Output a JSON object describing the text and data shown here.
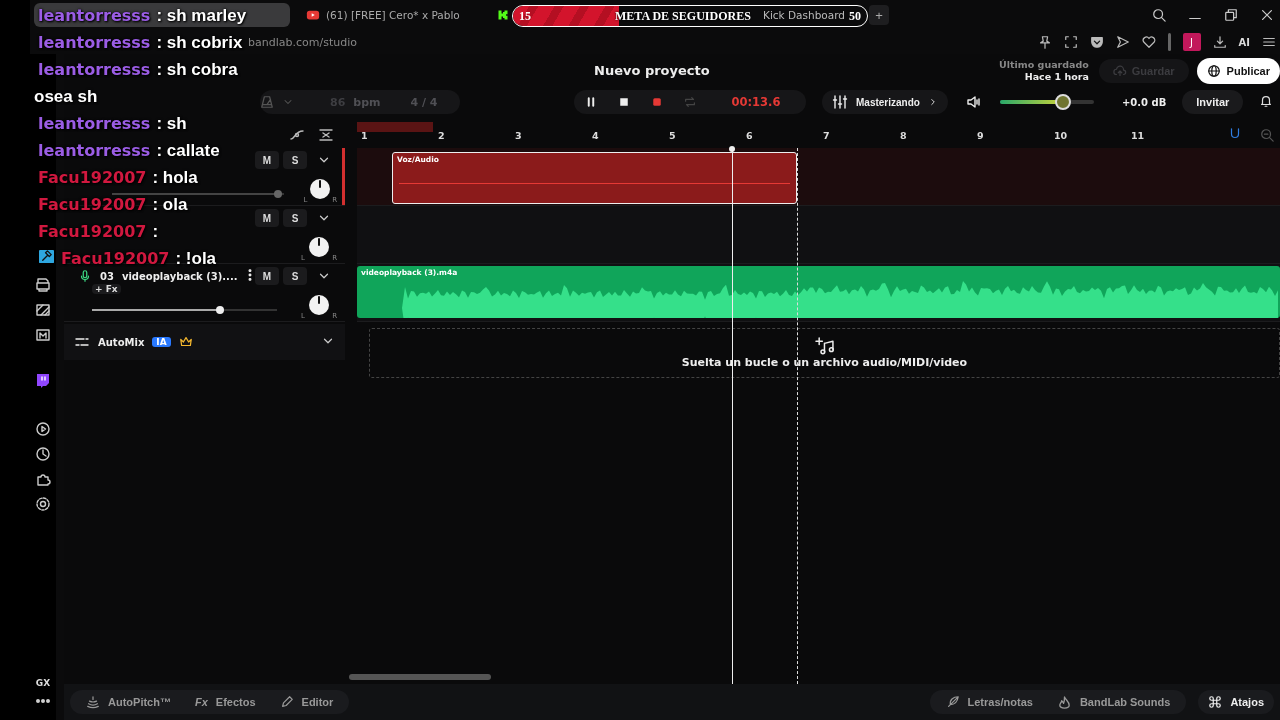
{
  "browser": {
    "tabs": [
      {
        "kind": "blank",
        "selected": true
      },
      {
        "kind": "video",
        "title": "(61) [FREE] Cero* x Pablo",
        "selected": false
      },
      {
        "kind": "kick",
        "title": "Kick Dashboard",
        "selected": false
      }
    ],
    "new_tab": "+",
    "address": "bandlab.com/studio",
    "avatar": "J",
    "ai": "AI",
    "sidebar_bottom": "GX"
  },
  "follower_goal": {
    "current": "15",
    "title": "META DE SEGUIDORES",
    "target": "50",
    "level": 0.3
  },
  "chat_overlay": {
    "messages": [
      {
        "user": "leantorresss",
        "color": "#9b5de5",
        "text": ": sh marley",
        "badge": false
      },
      {
        "user": "leantorresss",
        "color": "#9b5de5",
        "text": ": sh cobrix",
        "badge": false
      },
      {
        "user": "leantorresss",
        "color": "#9b5de5",
        "text": ": sh cobra",
        "badge": false
      },
      {
        "text": "osea sh"
      },
      {
        "user": "leantorresss",
        "color": "#9b5de5",
        "text": ": sh",
        "badge": false
      },
      {
        "user": "leantorresss",
        "color": "#9b5de5",
        "text": ": callate",
        "badge": false
      },
      {
        "user": "Facu192007",
        "color": "#d0183f",
        "text": ": hola",
        "badge": false
      },
      {
        "user": "Facu192007",
        "color": "#d0183f",
        "text": ": ola",
        "badge": false
      },
      {
        "user": "Facu192007",
        "color": "#d0183f",
        "text": ":",
        "badge": false
      },
      {
        "user": "Facu192007",
        "color": "#d0183f",
        "text": ": !ola",
        "badge": true
      }
    ]
  },
  "header": {
    "title": "Nuevo proyecto",
    "last_saved_label": "Último guardado",
    "last_saved": "Hace 1 hora",
    "save": "Guardar",
    "save_disabled": true,
    "publish": "Publicar"
  },
  "transport": {
    "bpm": "86",
    "bpm_unit": "bpm",
    "time_signature": "4 / 4",
    "time": "00:13.6",
    "recording": true,
    "mastering": "Masterizando",
    "volume": {
      "level": 0.67
    },
    "gain": "+0.0 dB",
    "invite": "Invitar"
  },
  "ruler": {
    "bars": [
      "1",
      "2",
      "3",
      "4",
      "5",
      "6",
      "7",
      "8",
      "9",
      "10",
      "11"
    ]
  },
  "tracks": [
    {
      "selected": true,
      "mute": "M",
      "solo": "S",
      "level": 0.97,
      "knob_l": "L",
      "knob_r": "R",
      "clip": {
        "kind": "midi",
        "name": "Voz/Audio"
      }
    },
    {
      "selected": false,
      "mute": "M",
      "solo": "S",
      "knob_l": "L",
      "knob_r": "R"
    },
    {
      "selected": false,
      "number": "03",
      "name": "videoplayback (3)....",
      "fx": "+ Fx",
      "mute": "M",
      "solo": "S",
      "level": 0.69,
      "knob_l": "L",
      "knob_r": "R",
      "clip": {
        "kind": "audio",
        "name": "videoplayback (3).m4a"
      }
    }
  ],
  "automix": {
    "label": "AutoMix",
    "badge": "IA"
  },
  "drop_zone": {
    "text": "Suelta un bucle o un archivo audio/MIDI/video"
  },
  "bottom_bar": {
    "left": [
      {
        "kind": "autopitch",
        "label": "AutoPitch™"
      },
      {
        "kind": "fx",
        "icon_text": "Fx",
        "label": "Efectos"
      },
      {
        "kind": "edit",
        "label": "Editor"
      }
    ],
    "right": [
      {
        "kind": "lyrics",
        "label": "Letras/notas"
      },
      {
        "kind": "sounds",
        "label": "BandLab Sounds"
      }
    ],
    "shortcuts": "Atajos"
  }
}
